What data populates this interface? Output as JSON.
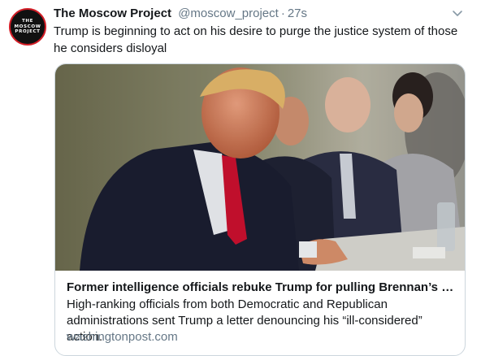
{
  "account": {
    "avatar_lines": [
      "THE",
      "MOSCOW",
      "PROJECT"
    ],
    "name": "The Moscow Project",
    "handle": "@moscow_project",
    "separator": "·",
    "time": "27s"
  },
  "tweet": {
    "text": "Trump is beginning to act on his desire to purge the justice system of those he considers disloyal"
  },
  "card": {
    "title": "Former intelligence officials rebuke Trump for pulling Brennan’s secu...",
    "description": "High-ranking officials from both Democratic and Republican administrations sent Trump a letter denouncing his “ill-considered” action.",
    "domain": "washingtonpost.com"
  },
  "icons": {
    "menu": "chevron-down-icon"
  },
  "colors": {
    "text": "#14171a",
    "secondary": "#657786",
    "card_border": "#ccd6dd",
    "tie_red": "#c8102e",
    "avatar_ring": "#d21d26"
  }
}
